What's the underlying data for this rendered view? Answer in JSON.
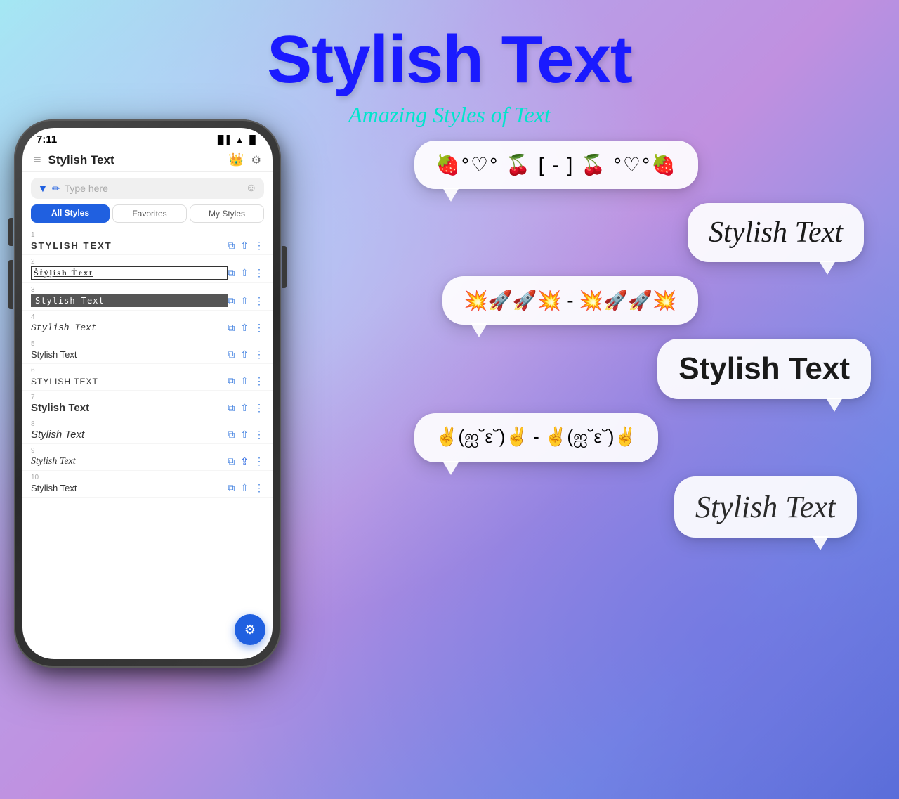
{
  "header": {
    "title": "Stylish Text",
    "subtitle": "Amazing Styles of Text",
    "time": "7:11"
  },
  "app": {
    "name": "Stylish Text",
    "tabs": {
      "all": "All Styles",
      "favorites": "Favorites",
      "myStyles": "My Styles"
    },
    "search_placeholder": "Type here"
  },
  "items": [
    {
      "id": "1",
      "text": "STYLISH TEXT",
      "style": "style1"
    },
    {
      "id": "2",
      "text": "ṠṪẎḶỊṠḤ ṪḔẌṪ",
      "style": "style2"
    },
    {
      "id": "3",
      "text": "Stylish Text",
      "style": "style3"
    },
    {
      "id": "4",
      "text": "Stylish Text",
      "style": "style4"
    },
    {
      "id": "5",
      "text": "Stylish Text",
      "style": "style5"
    },
    {
      "id": "6",
      "text": "STYLISH TEXT",
      "style": "style6"
    },
    {
      "id": "7",
      "text": "Stylish Text",
      "style": "style7"
    },
    {
      "id": "8",
      "text": "Stylish Text",
      "style": "style8"
    },
    {
      "id": "9",
      "text": "Stylish Text",
      "style": "style9"
    },
    {
      "id": "10",
      "text": "Stylish Text",
      "style": "style10"
    }
  ],
  "bubbles": [
    {
      "id": "1",
      "text": "🍓°♡° 🍒 [ - ] 🍒 °♡°🍓",
      "class": "bubble1",
      "textClass": "bubble-text-1",
      "tail": "left"
    },
    {
      "id": "2",
      "text": "Stylish Text",
      "class": "bubble2",
      "textClass": "bubble-text-2",
      "tail": "right"
    },
    {
      "id": "3",
      "text": "💥🚀🚀💥 - 💥🚀🚀💥",
      "class": "bubble3",
      "textClass": "bubble-text-3",
      "tail": "left"
    },
    {
      "id": "4",
      "text": "Stylish Text",
      "class": "bubble4",
      "textClass": "bubble-text-4",
      "tail": "right"
    },
    {
      "id": "5",
      "text": "✌️(ஐ˘̩̩̩̩̩̩͙ε˘̩ͅ͏͙)✌️ - ✌️(ஐ˘̩̩̩̩̩̩͙ε˘̩ͅ͏͙)✌️",
      "class": "bubble5",
      "textClass": "bubble-text-5",
      "tail": "left"
    },
    {
      "id": "6",
      "text": "Stylish Text",
      "class": "bubble6",
      "textClass": "bubble-text-6",
      "tail": "right"
    }
  ]
}
